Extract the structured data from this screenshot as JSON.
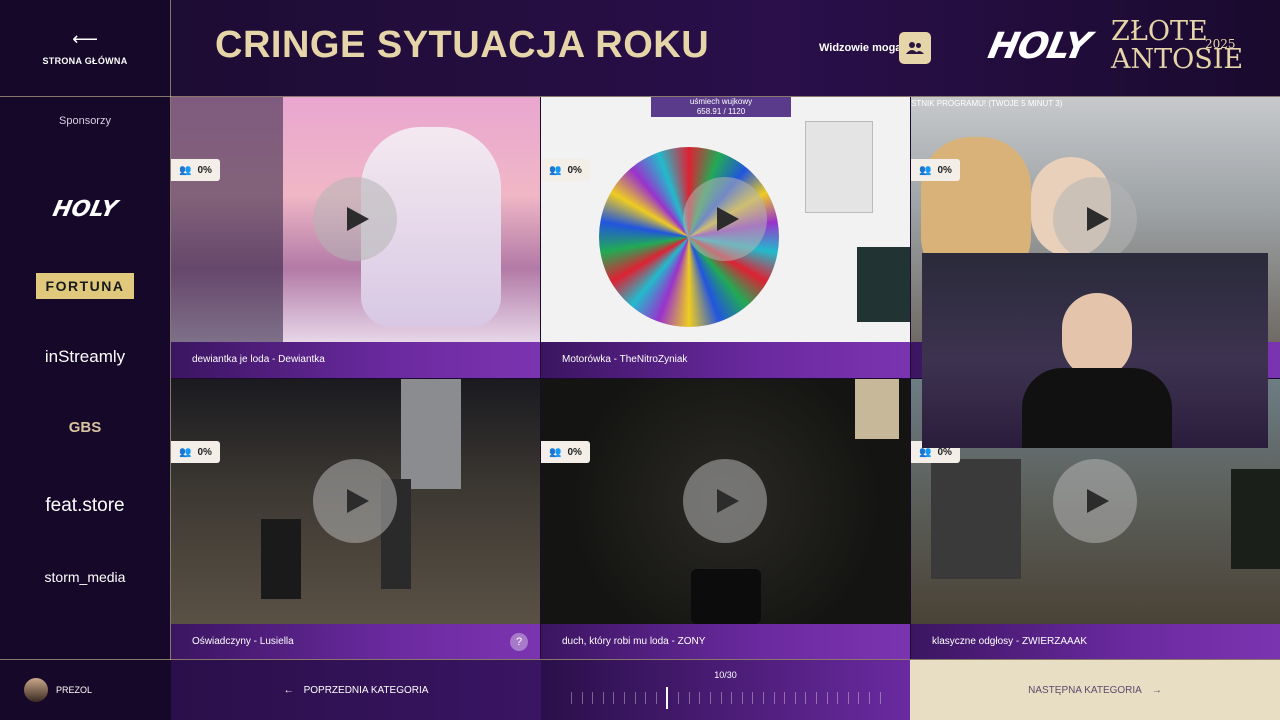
{
  "home": {
    "label": "STRONA GŁÓWNA"
  },
  "header": {
    "title": "CRINGE SYTUACJA ROKU",
    "viewers_label": "Widzowie mogą",
    "brand": "HOLY",
    "award_line1": "ZŁOTE",
    "award_line2": "ANTOSIE",
    "award_year": "2025"
  },
  "sidebar": {
    "label": "Sponsorzy",
    "sponsors": [
      "HOLY",
      "FORTUNA",
      "inStreamly",
      "GBS",
      "feat.store",
      "storm_media"
    ]
  },
  "tiles": [
    {
      "caption": "dewiantka je loda - Dewiantka",
      "pct": "0%"
    },
    {
      "caption": "Motorówka - TheNitroZyniak",
      "pct": "0%",
      "overlay_title": "uśmiech wujkowy",
      "overlay_value": "658.91 / 1120"
    },
    {
      "caption": "",
      "pct": "0%",
      "overlay_title": "STNIK PROGRAMU! (TWOJE 5 MINUT 3)"
    },
    {
      "caption": "Oświadczyny - Lusiella",
      "pct": "0%",
      "help": "?"
    },
    {
      "caption": "duch, który robi mu loda - ZONY",
      "pct": "0%"
    },
    {
      "caption": "klasyczne odgłosy - ZWIERZAAAK",
      "pct": "0%"
    }
  ],
  "footer": {
    "user": "PREZOL",
    "prev_label": "POPRZEDNIA KATEGORIA",
    "progress": "10/30",
    "current": 10,
    "total": 30,
    "next_label": "NASTĘPNA KATEGORIA"
  },
  "colors": {
    "gold": "#e6d5a8",
    "purple": "#6b2aa0",
    "bg": "#150828"
  }
}
